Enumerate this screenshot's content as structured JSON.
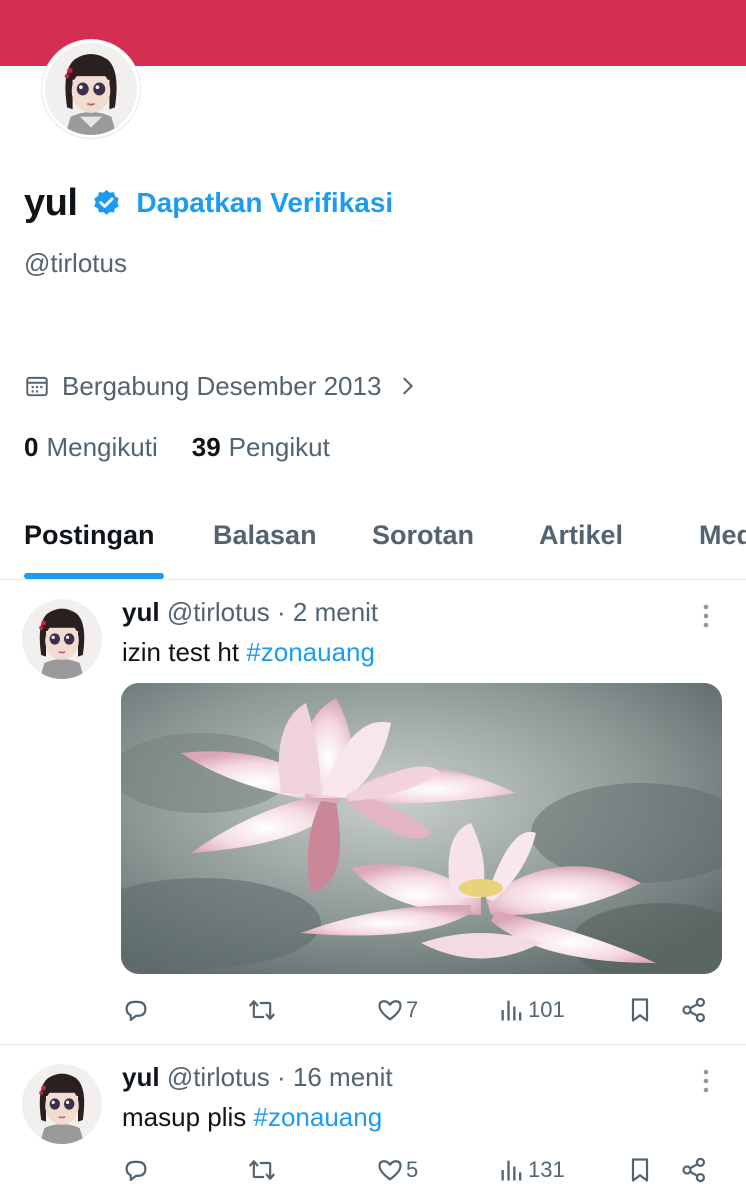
{
  "profile": {
    "display_name": "yul",
    "get_verified_label": "Dapatkan Verifikasi",
    "handle": "@tirlotus",
    "joined": "Bergabung Desember 2013",
    "following_count": "0",
    "following_label": "Mengikuti",
    "followers_count": "39",
    "followers_label": "Pengikut"
  },
  "tabs": [
    {
      "label": "Postingan"
    },
    {
      "label": "Balasan"
    },
    {
      "label": "Sorotan"
    },
    {
      "label": "Artikel"
    },
    {
      "label": "Med"
    }
  ],
  "posts": [
    {
      "name": "yul",
      "handle_time": "@tirlotus · 2 menit",
      "text": "izin test ht ",
      "hashtag": "#zonauang",
      "likes": "7",
      "views": "101"
    },
    {
      "name": "yul",
      "handle_time": "@tirlotus · 16 menit",
      "text": "masup plis ",
      "hashtag": "#zonauang",
      "likes": "5",
      "views": "131"
    }
  ],
  "colors": {
    "banner": "#d42e52",
    "accent": "#1d9bf0",
    "secondary_text": "#536471"
  },
  "icons": {
    "verified": "verified-badge-icon",
    "joined": "calendar-icon",
    "more": "more-vertical-icon",
    "reply": "reply-icon",
    "repost": "repost-icon",
    "like": "heart-icon",
    "views": "views-bar-icon",
    "bookmark": "bookmark-icon",
    "share": "share-icon"
  }
}
